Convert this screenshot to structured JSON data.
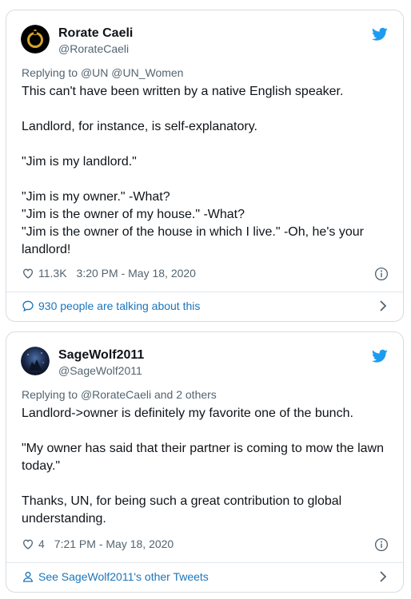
{
  "tweets": [
    {
      "author_name": "Rorate Caeli",
      "author_handle": "@RorateCaeli",
      "reply_prefix": "Replying to",
      "reply_targets": "@UN @UN_Women",
      "body_lines": [
        "This can't have been written by a native English speaker.",
        "",
        "Landlord, for instance, is self-explanatory.",
        "",
        "\"Jim is my landlord.\"",
        "",
        "\"Jim is my owner.\"   -What?",
        "\"Jim is the owner of my house.\"  -What?",
        "\"Jim is the owner of the house in which I live.\"  -Oh, he's your",
        "landlord!"
      ],
      "likes": "11.3K",
      "timestamp": "3:20 PM - May 18, 2020",
      "footer_text": "930 people are talking about this",
      "footer_icon": "chat-bubble-icon"
    },
    {
      "author_name": "SageWolf2011",
      "author_handle": "@SageWolf2011",
      "reply_prefix": "Replying to",
      "reply_targets": "@RorateCaeli and 2 others",
      "body_lines": [
        "Landlord->owner is definitely my favorite one of the bunch.",
        "",
        "\"My owner has said that their partner is coming to mow the lawn",
        "today.\"",
        "",
        "Thanks, UN, for being such a great contribution to global",
        "understanding."
      ],
      "likes": "4",
      "timestamp": "7:21 PM - May 18, 2020",
      "footer_text": "See SageWolf2011's other Tweets",
      "footer_icon": "person-icon"
    }
  ],
  "colors": {
    "twitter_blue": "#1d9bf0",
    "link_blue": "#1b75bb",
    "muted_text": "#536471",
    "border": "#d6dce1"
  }
}
